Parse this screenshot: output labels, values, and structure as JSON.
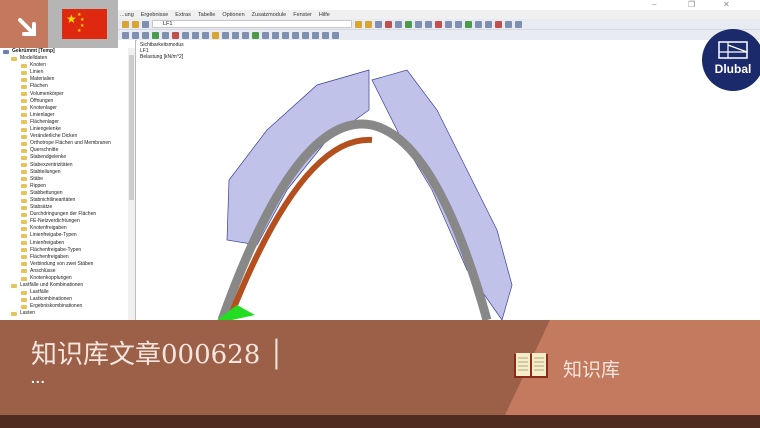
{
  "window": {
    "controls": [
      "–",
      "❐",
      "✕"
    ]
  },
  "menu": [
    "...ung",
    "Ergebnisse",
    "Extras",
    "Tabelle",
    "Optionen",
    "Zusatzmodule",
    "Fenster",
    "Hilfe"
  ],
  "toolbar": {
    "loadcase": "LF1"
  },
  "tree": {
    "root": "Gekrümmt [Temp]",
    "items": [
      "Modelldaten",
      "Knoten",
      "Linien",
      "Materialien",
      "Flächen",
      "Volumenkörper",
      "Öffnungen",
      "Knotenlager",
      "Linienlager",
      "Flächenlager",
      "Liniengelenke",
      "Veränderliche Dicken",
      "Orthotrope Flächen und Membranen",
      "Querschnitte",
      "Stabendgelenke",
      "Stabexzentrizitäten",
      "Stabteilungen",
      "Stäbe",
      "Rippen",
      "Stabbettungen",
      "Stabnichtlinearitäten",
      "Stabsätze",
      "Durchdringungen der Flächen",
      "FE-Netzverdichtungen",
      "Knotenfreigaben",
      "Linienfreigabe-Typen",
      "Linienfreigaben",
      "Flächenfreigabe-Typen",
      "Flächenfreigaben",
      "Verbindung von zwei Stäben",
      "Anschlüsse",
      "Knotenkopplungen",
      "Lastfälle und Kombinationen",
      "Lastfälle",
      "Lastkombinationen",
      "Ergebniskombinationen",
      "Lasten"
    ]
  },
  "viewport": {
    "mode": "Sichtbarkeitsmodus",
    "loadcase": "LF1",
    "label": "Belastung [kN/m^2]"
  },
  "logo": "Dlubal",
  "banner": {
    "title": "知识库文章000628 │",
    "more": "...",
    "category": "知识库"
  },
  "colors": {
    "banner": "#9c5f48",
    "accent": "#c47a5e",
    "footer": "#4f2b20",
    "logo": "#1b2a6b"
  }
}
